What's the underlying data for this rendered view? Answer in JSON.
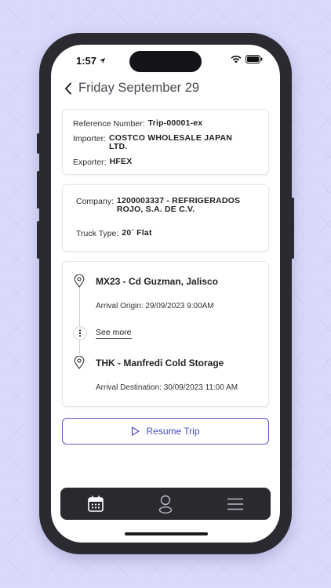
{
  "status_bar": {
    "time": "1:57"
  },
  "header": {
    "title": "Friday September 29"
  },
  "trip_card": {
    "reference_label": "Reference Number:",
    "reference_value": "Trip-00001-ex",
    "importer_label": "Importer:",
    "importer_value": "COSTCO WHOLESALE JAPAN LTD.",
    "exporter_label": "Exporter:",
    "exporter_value": "HFEX"
  },
  "company_card": {
    "company_label": "Company:",
    "company_value": "1200003337 - REFRIGERADOS ROJO, S.A. DE C.V.",
    "truck_label": "Truck Type:",
    "truck_value": "20´ Flat"
  },
  "route_card": {
    "origin_name": "MX23 - Cd Guzman, Jalisco",
    "origin_arrival": "Arrival Origin: 29/09/2023 9:00AM",
    "see_more": "See more",
    "destination_name": "THK - Manfredi Cold Storage",
    "destination_arrival": "Arrival Destination: 30/09/2023 11:00 AM"
  },
  "actions": {
    "resume_label": "Resume Trip"
  },
  "tabbar": {
    "tabs": [
      "calendar-icon",
      "user-icon",
      "menu-icon"
    ]
  },
  "colors": {
    "accent": "#4b49c2",
    "background": "#d9d9fb",
    "tabbar": "#2a292f"
  }
}
